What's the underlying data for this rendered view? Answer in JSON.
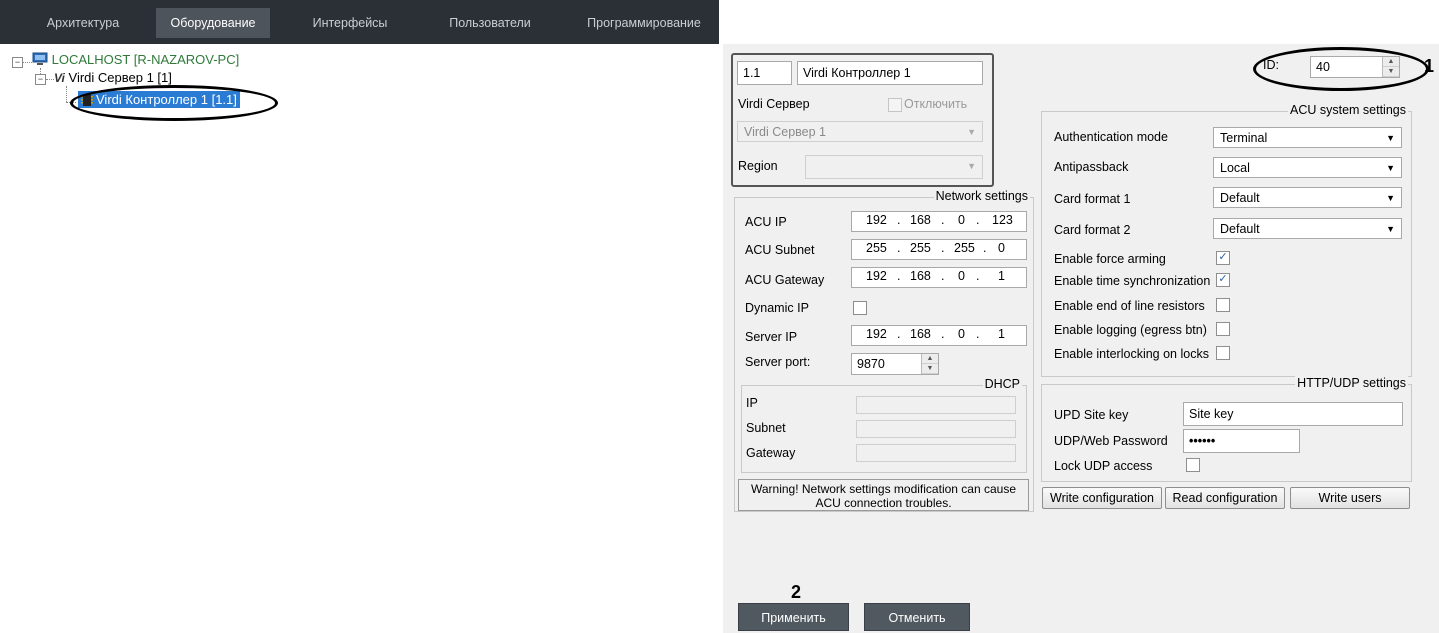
{
  "tabs": [
    {
      "label": "Архитектура",
      "active": false
    },
    {
      "label": "Оборудование",
      "active": true
    },
    {
      "label": "Интерфейсы",
      "active": false
    },
    {
      "label": "Пользователи",
      "active": false
    },
    {
      "label": "Программирование",
      "active": false
    }
  ],
  "tree": {
    "root": "LOCALHOST [R-NAZAROV-PC]",
    "server": "Virdi Сервер 1 [1]",
    "controller": "Virdi Контроллер 1 [1.1]"
  },
  "annotations": {
    "one": "1",
    "two": "2"
  },
  "device": {
    "number": "1.1",
    "name": "Virdi Контроллер 1",
    "parent_label": "Virdi Сервер",
    "disable_label": "Отключить",
    "parent_value": "Virdi Сервер 1",
    "region_label": "Region",
    "region_value": "",
    "id_label": "ID:",
    "id_value": "40"
  },
  "network": {
    "title": "Network settings",
    "acu_ip_label": "ACU IP",
    "acu_ip": [
      "192",
      "168",
      "0",
      "123"
    ],
    "acu_subnet_label": "ACU Subnet",
    "acu_subnet": [
      "255",
      "255",
      "255",
      "0"
    ],
    "acu_gateway_label": "ACU Gateway",
    "acu_gateway": [
      "192",
      "168",
      "0",
      "1"
    ],
    "dynamic_ip_label": "Dynamic IP",
    "dynamic_ip": false,
    "server_ip_label": "Server IP",
    "server_ip": [
      "192",
      "168",
      "0",
      "1"
    ],
    "server_port_label": "Server port:",
    "server_port": "9870",
    "dhcp": {
      "title": "DHCP",
      "ip_label": "IP",
      "subnet_label": "Subnet",
      "gateway_label": "Gateway"
    },
    "warning_line1": "Warning! Network settings modification can cause",
    "warning_line2": "ACU connection troubles."
  },
  "acu": {
    "title": "ACU system settings",
    "auth_label": "Authentication mode",
    "auth_value": "Terminal",
    "antipassback_label": "Antipassback",
    "antipassback_value": "Local",
    "card1_label": "Card format 1",
    "card1_value": "Default",
    "card2_label": "Card format 2",
    "card2_value": "Default",
    "force_arming_label": "Enable force arming",
    "force_arming": true,
    "time_sync_label": "Enable time synchronization",
    "time_sync": true,
    "eol_label": "Enable end of line resistors",
    "eol": false,
    "logging_label": "Enable logging (egress btn)",
    "logging": false,
    "interlocking_label": "Enable interlocking on locks",
    "interlocking": false
  },
  "http": {
    "title": "HTTP/UDP settings",
    "site_key_label": "UPD Site key",
    "site_key_value": "Site key",
    "password_label": "UDP/Web Password",
    "password_value": "••••••",
    "lock_label": "Lock UDP access",
    "lock": false
  },
  "buttons": {
    "write_config": "Write configuration",
    "read_config": "Read configuration",
    "write_users": "Write users",
    "apply": "Применить",
    "cancel": "Отменить"
  },
  "colors": {
    "topbar": "#2b3036",
    "active_tab": "#4d545b",
    "tree_text": "#2f7a3a",
    "panel": "#f0f0f0"
  }
}
